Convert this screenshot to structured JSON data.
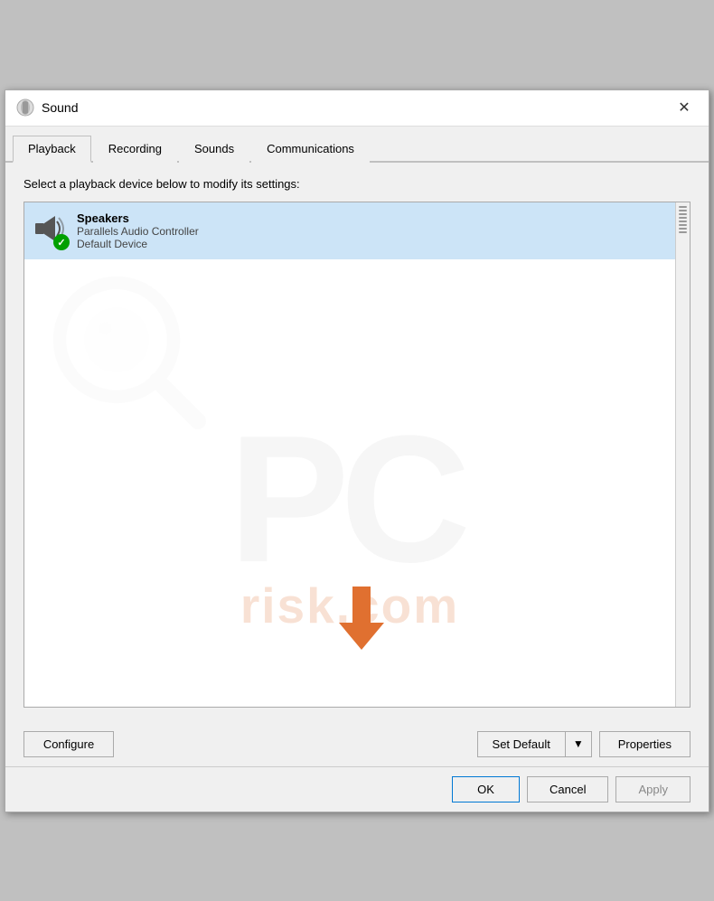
{
  "window": {
    "title": "Sound",
    "icon": "🔊"
  },
  "tabs": [
    {
      "id": "playback",
      "label": "Playback",
      "active": true
    },
    {
      "id": "recording",
      "label": "Recording",
      "active": false
    },
    {
      "id": "sounds",
      "label": "Sounds",
      "active": false
    },
    {
      "id": "communications",
      "label": "Communications",
      "active": false
    }
  ],
  "content": {
    "description": "Select a playback device below to modify its settings:",
    "device": {
      "name": "Speakers",
      "subtitle1": "Parallels Audio Controller",
      "subtitle2": "Default Device"
    }
  },
  "buttons": {
    "configure": "Configure",
    "set_default": "Set Default",
    "properties": "Properties",
    "ok": "OK",
    "cancel": "Cancel",
    "apply": "Apply"
  }
}
